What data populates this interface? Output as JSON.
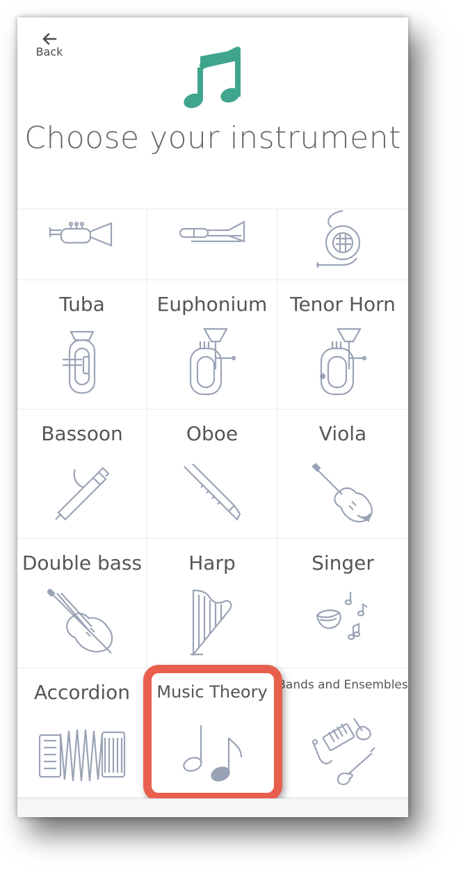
{
  "header": {
    "back_label": "Back",
    "title": "Choose your instrument",
    "logo_icon": "music-note-logo-icon",
    "logo_color": "#3fa58c"
  },
  "grid": {
    "row0": [
      {
        "label": "",
        "icon": "trumpet-icon"
      },
      {
        "label": "",
        "icon": "trombone-icon"
      },
      {
        "label": "",
        "icon": "french-horn-icon"
      }
    ],
    "row1": [
      {
        "label": "Tuba",
        "icon": "tuba-icon"
      },
      {
        "label": "Euphonium",
        "icon": "euphonium-icon"
      },
      {
        "label": "Tenor Horn",
        "icon": "tenor-horn-icon"
      }
    ],
    "row2": [
      {
        "label": "Bassoon",
        "icon": "bassoon-icon"
      },
      {
        "label": "Oboe",
        "icon": "oboe-icon"
      },
      {
        "label": "Viola",
        "icon": "viola-icon"
      }
    ],
    "row3": [
      {
        "label": "Double bass",
        "icon": "double-bass-icon"
      },
      {
        "label": "Harp",
        "icon": "harp-icon"
      },
      {
        "label": "Singer",
        "icon": "singer-icon"
      }
    ],
    "row4": [
      {
        "label": "Accordion",
        "icon": "accordion-icon"
      },
      {
        "label": "Music Theory",
        "icon": "music-notes-icon"
      },
      {
        "label": "Bands and Ensembles",
        "icon": "ensemble-icon"
      }
    ]
  },
  "colors": {
    "icon_stroke": "#9aa3b5",
    "highlight_border": "#e85f4e"
  }
}
